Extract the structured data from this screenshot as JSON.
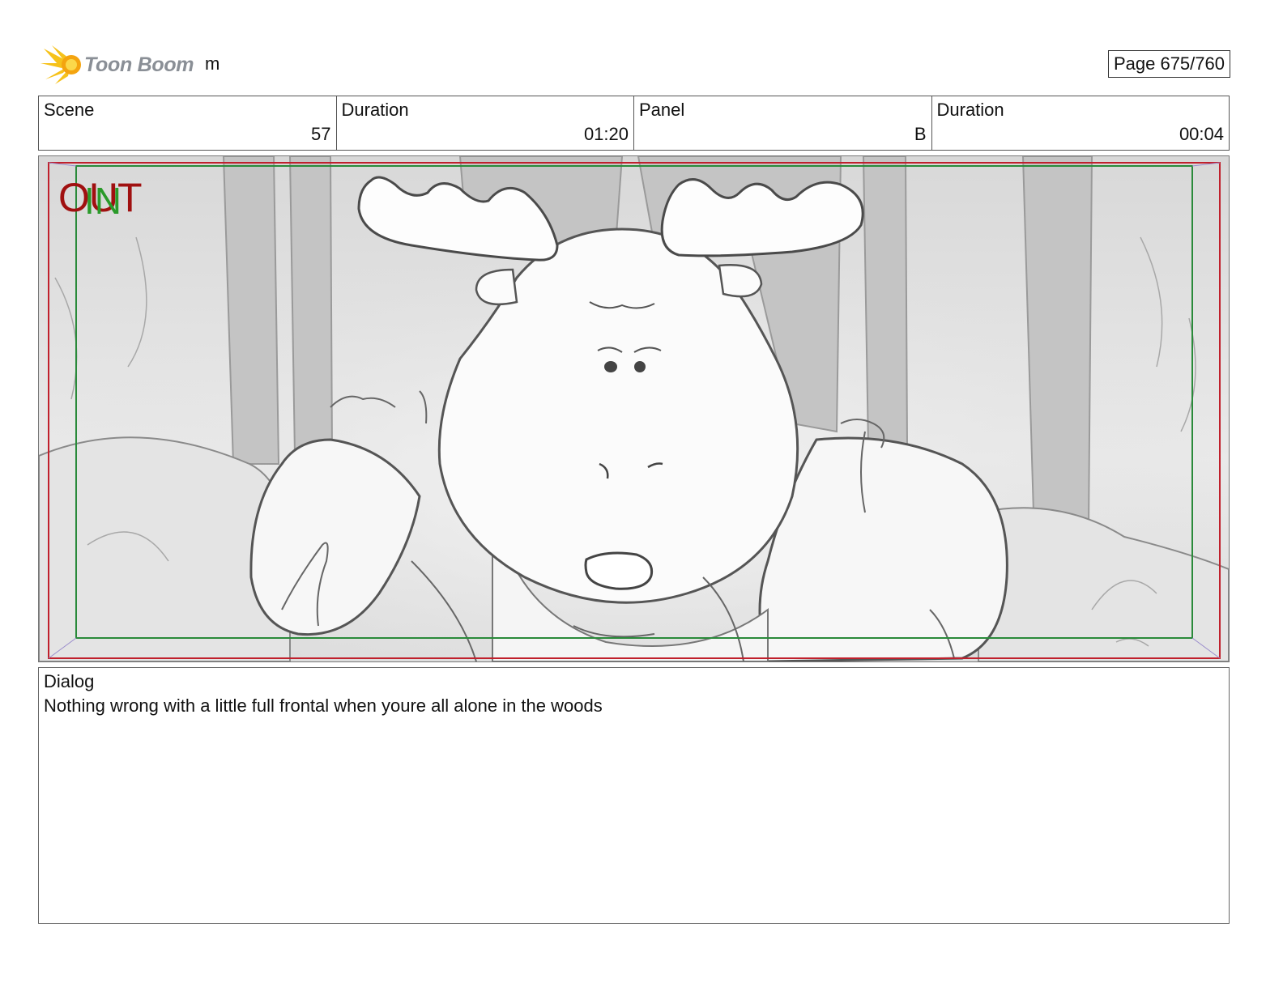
{
  "header": {
    "logo_text": "Toon Boom",
    "project_name": "m",
    "page_label": "Page 675/760"
  },
  "info": [
    {
      "label": "Scene",
      "value": "57"
    },
    {
      "label": "Duration",
      "value": "01:20"
    },
    {
      "label": "Panel",
      "value": "B"
    },
    {
      "label": "Duration",
      "value": "00:04"
    }
  ],
  "panel": {
    "stamp_out": "OUT",
    "stamp_in": "IN",
    "colors": {
      "out": "#a01010",
      "in": "#2a9a2a",
      "safe_frame_red": "#c0202c",
      "safe_frame_green": "#2a8a3a"
    }
  },
  "dialog": {
    "label": "Dialog",
    "text": "Nothing wrong with a little full frontal when youre all alone in the woods"
  }
}
